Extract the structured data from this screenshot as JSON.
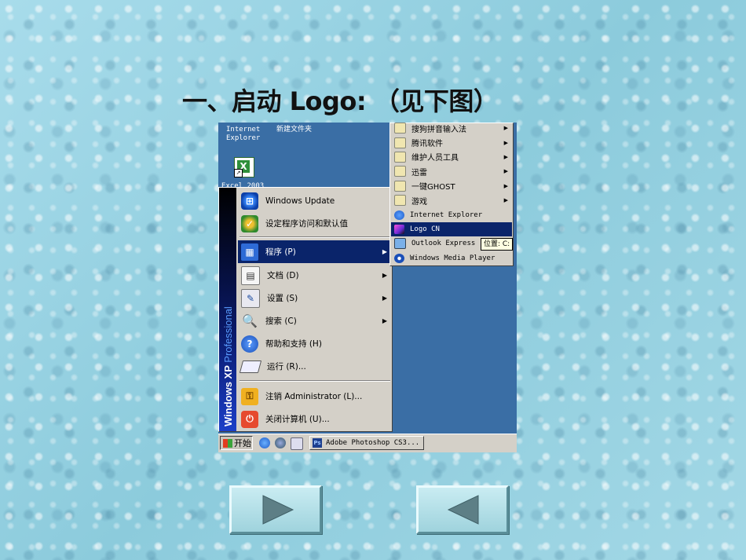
{
  "slide": {
    "title": "一、启动 Logo: （见下图）"
  },
  "desktop": {
    "icon_ie_label": "Internet\nExplorer",
    "icon_folder_label": "新建文件夹",
    "icon_excel_label": "Excel 2003"
  },
  "start_menu": {
    "banner_windows": "Windows XP",
    "banner_edition": "Professional",
    "items": [
      {
        "label": "Windows Update",
        "icon": "windows-update-icon"
      },
      {
        "label": "设定程序访问和默认值",
        "icon": "program-access-icon"
      },
      {
        "label": "程序 (P)",
        "icon": "programs-icon",
        "arrow": "▶"
      },
      {
        "label": "文档 (D)",
        "icon": "documents-icon",
        "arrow": "▶"
      },
      {
        "label": "设置 (S)",
        "icon": "settings-icon",
        "arrow": "▶"
      },
      {
        "label": "搜索 (C)",
        "icon": "search-icon",
        "arrow": "▶"
      },
      {
        "label": "帮助和支持 (H)",
        "icon": "help-icon"
      },
      {
        "label": "运行 (R)...",
        "icon": "run-icon"
      },
      {
        "label": "注销 Administrator (L)...",
        "icon": "logoff-icon"
      },
      {
        "label": "关闭计算机 (U)...",
        "icon": "shutdown-icon"
      }
    ]
  },
  "programs_submenu": {
    "items": [
      {
        "label": "搜狗拼音输入法",
        "arrow": "▶"
      },
      {
        "label": "腾讯软件",
        "arrow": "▶"
      },
      {
        "label": "维护人员工具",
        "arrow": "▶"
      },
      {
        "label": "迅雷",
        "arrow": "▶"
      },
      {
        "label": "一键GHOST",
        "arrow": "▶"
      },
      {
        "label": "游戏",
        "arrow": "▶"
      },
      {
        "label": "Internet Explorer"
      },
      {
        "label": "Logo CN"
      },
      {
        "label": "Outlook Express"
      },
      {
        "label": "Windows Media Player"
      }
    ],
    "tooltip": "位置: C:"
  },
  "taskbar": {
    "start_label": "开始",
    "task_label": "Adobe Photoshop CS3..."
  },
  "nav": {
    "next_icon": "play-right-icon",
    "prev_icon": "play-left-icon"
  },
  "colors": {
    "highlight": "#0a246a",
    "menu_bg": "#d4d0c8",
    "desktop": "#3a6ea5",
    "slide_bg": "#9fd6e4"
  }
}
